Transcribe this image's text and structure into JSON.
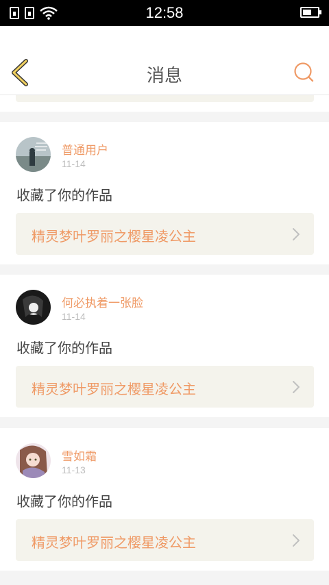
{
  "status_bar": {
    "time": "12:58"
  },
  "header": {
    "title": "消息"
  },
  "colors": {
    "accent": "#ef9a66",
    "back_arrow": "#f0d060",
    "link_bg": "#f4f3ec"
  },
  "icons": {
    "back": "chevron-left-icon",
    "search": "search-icon",
    "link_arrow": "chevron-right-icon"
  },
  "messages": [
    {
      "username": "普通用户",
      "date": "11-14",
      "action": "收藏了你的作品",
      "work_title": "精灵梦叶罗丽之樱星凌公主"
    },
    {
      "username": "何必执着一张脸",
      "date": "11-14",
      "action": "收藏了你的作品",
      "work_title": "精灵梦叶罗丽之樱星凌公主"
    },
    {
      "username": "雪如霜",
      "date": "11-13",
      "action": "收藏了你的作品",
      "work_title": "精灵梦叶罗丽之樱星凌公主"
    }
  ]
}
